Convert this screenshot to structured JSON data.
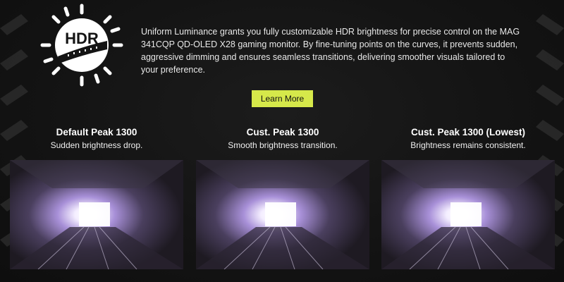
{
  "intro": {
    "text": "Uniform Luminance grants you fully customizable HDR brightness for precise control on the MAG 341CQP QD-OLED X28 gaming monitor. By fine-tuning points on the curves, it prevents sudden, aggressive dimming and ensures seamless transitions, delivering smoother visuals tailored to your preference."
  },
  "logo": {
    "label": "HDR",
    "icon": "hdr-sun-icon"
  },
  "cta": {
    "label": "Learn More",
    "color": "#d6e84a"
  },
  "comparisons": [
    {
      "title": "Default Peak 1300",
      "subtitle": "Sudden brightness drop.",
      "image": "tunnel-light-image"
    },
    {
      "title": "Cust. Peak 1300",
      "subtitle": "Smooth brightness transition.",
      "image": "tunnel-light-image"
    },
    {
      "title": "Cust. Peak 1300 (Lowest)",
      "subtitle": "Brightness remains consistent.",
      "image": "tunnel-light-image"
    }
  ],
  "colors": {
    "background": "#141414",
    "accent": "#d6e84a",
    "text": "#ffffff"
  }
}
